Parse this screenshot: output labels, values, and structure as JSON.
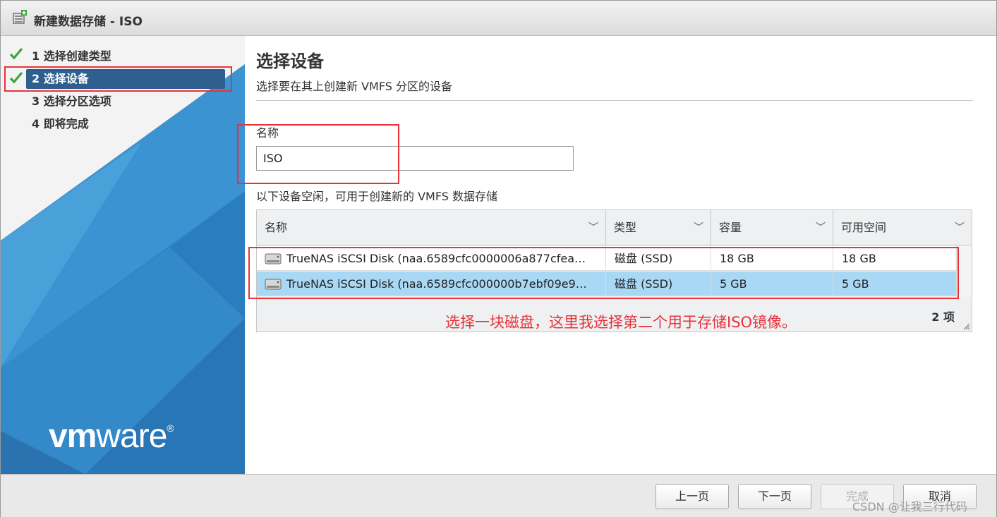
{
  "window": {
    "title": "新建数据存储 - ISO"
  },
  "sidebar": {
    "steps": [
      {
        "label": "1 选择创建类型",
        "completed": true,
        "active": false
      },
      {
        "label": "2 选择设备",
        "completed": true,
        "active": true
      },
      {
        "label": "3 选择分区选项",
        "completed": false,
        "active": false
      },
      {
        "label": "4 即将完成",
        "completed": false,
        "active": false
      }
    ],
    "logo": {
      "bold": "vm",
      "light": "ware",
      "mark": "®"
    }
  },
  "main": {
    "heading": "选择设备",
    "subheading": "选择要在其上创建新 VMFS 分区的设备",
    "name_label": "名称",
    "name_value": "ISO",
    "info_text": "以下设备空闲，可用于创建新的 VMFS 数据存储",
    "table": {
      "columns": [
        "名称",
        "类型",
        "容量",
        "可用空间"
      ],
      "rows": [
        {
          "name": "TrueNAS iSCSI Disk (naa.6589cfc0000006a877cfea…",
          "type": "磁盘 (SSD)",
          "capacity": "18 GB",
          "free": "18 GB",
          "selected": false
        },
        {
          "name": "TrueNAS iSCSI Disk (naa.6589cfc000000b7ebf09e9…",
          "type": "磁盘 (SSD)",
          "capacity": "5 GB",
          "free": "5 GB",
          "selected": true
        }
      ],
      "count": "2 项"
    },
    "annotation": "选择一块磁盘，这里我选择第二个用于存储ISO镜像。"
  },
  "footer": {
    "back": "上一页",
    "next": "下一页",
    "finish": "完成",
    "cancel": "取消",
    "watermark": "CSDN @让我三行代码"
  },
  "colors": {
    "accent": "#2e5f8f",
    "selection": "#a9d8f5",
    "highlight": "#e8333a",
    "check": "#3aa63a"
  },
  "icons": [
    "datastore-add-icon",
    "check-icon",
    "disk-icon",
    "chevron-down-icon",
    "resize-grip-icon"
  ]
}
